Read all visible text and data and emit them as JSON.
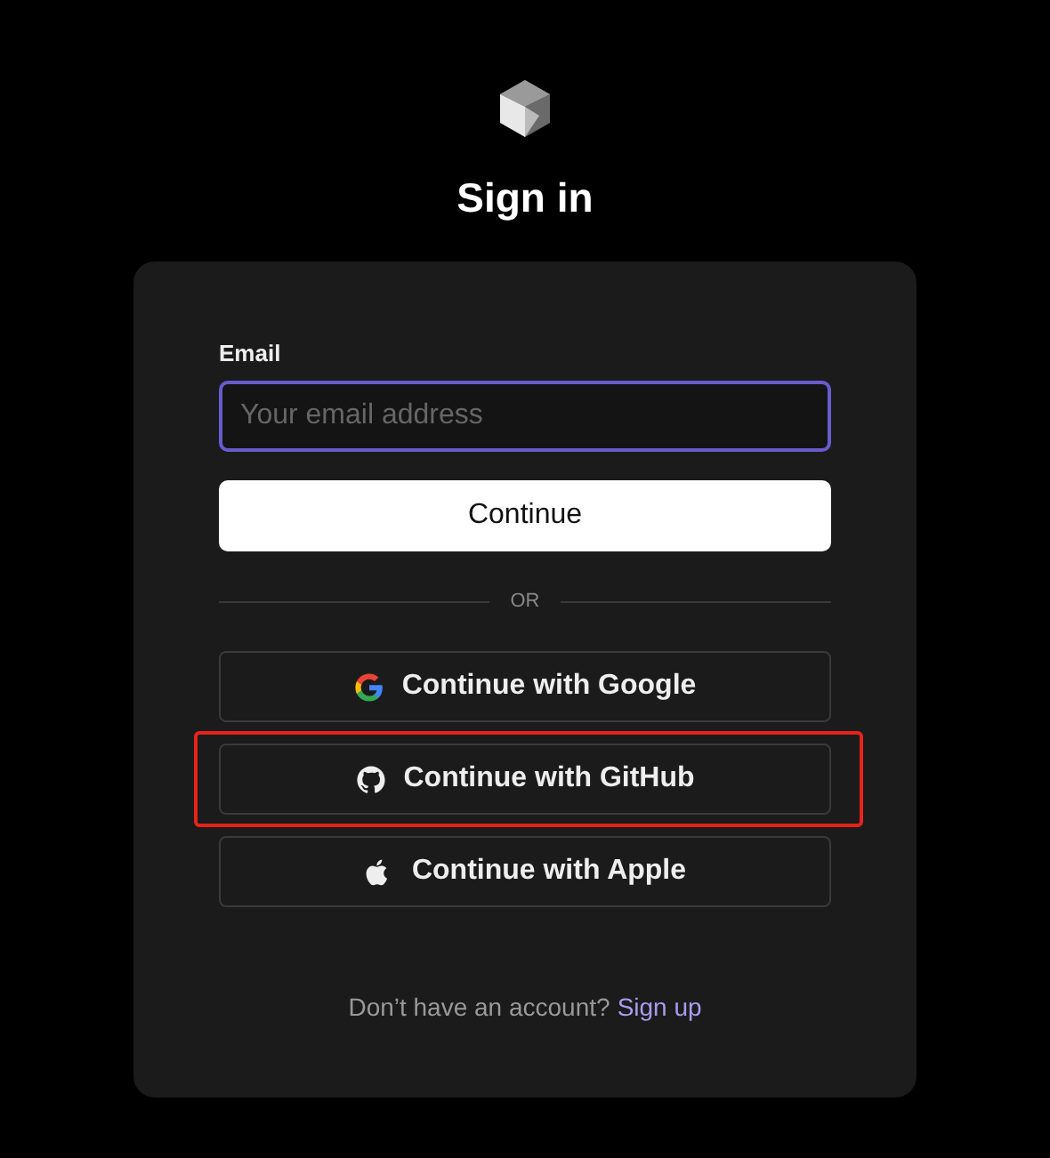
{
  "title": "Sign in",
  "email": {
    "label": "Email",
    "placeholder": "Your email address",
    "focused": true
  },
  "continue_button": "Continue",
  "divider": "OR",
  "providers": [
    {
      "kind": "google",
      "label": "Continue with Google",
      "highlighted": false
    },
    {
      "kind": "github",
      "label": "Continue with GitHub",
      "highlighted": true
    },
    {
      "kind": "apple",
      "label": "Continue with Apple",
      "highlighted": false
    }
  ],
  "footer": {
    "text": "Don’t have an account?",
    "link": "Sign up"
  }
}
